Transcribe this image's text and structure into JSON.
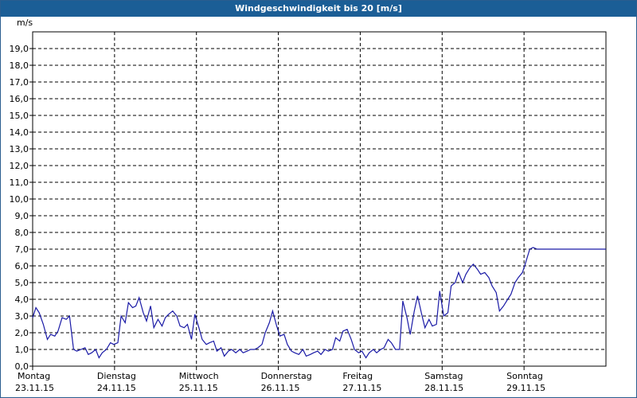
{
  "window": {
    "title": "Windgeschwindigkeit bis 20 [m/s]"
  },
  "colors": {
    "titlebar": "#1b5e96",
    "line": "#1a1aa6",
    "grid": "#000000"
  },
  "chart_data": {
    "type": "line",
    "title": "Windgeschwindigkeit bis 20 [m/s]",
    "ylabel": "m/s",
    "ylim": [
      0,
      20
    ],
    "yticks": [
      "0,0",
      "1,0",
      "2,0",
      "3,0",
      "4,0",
      "5,0",
      "6,0",
      "7,0",
      "8,0",
      "9,0",
      "10,0",
      "11,0",
      "12,0",
      "13,0",
      "14,0",
      "15,0",
      "16,0",
      "17,0",
      "18,0",
      "19,0"
    ],
    "ytick_values": [
      0,
      1,
      2,
      3,
      4,
      5,
      6,
      7,
      8,
      9,
      10,
      11,
      12,
      13,
      14,
      15,
      16,
      17,
      18,
      19
    ],
    "xlim": [
      0,
      7
    ],
    "day_ticks": [
      {
        "x": 0,
        "day": "Montag",
        "date": "23.11.15"
      },
      {
        "x": 1,
        "day": "Dienstag",
        "date": "24.11.15"
      },
      {
        "x": 2,
        "day": "Mittwoch",
        "date": "25.11.15"
      },
      {
        "x": 3,
        "day": "Donnerstag",
        "date": "26.11.15"
      },
      {
        "x": 4,
        "day": "Freitag",
        "date": "27.11.15"
      },
      {
        "x": 5,
        "day": "Samstag",
        "date": "28.11.15"
      },
      {
        "x": 6,
        "day": "Sonntag",
        "date": "29.11.15"
      }
    ],
    "grid": true,
    "series": [
      {
        "x": [
          0,
          0.04,
          0.08,
          0.13,
          0.18,
          0.22,
          0.27,
          0.31,
          0.36,
          0.41,
          0.45,
          0.5,
          0.54,
          0.59,
          0.64,
          0.68,
          0.72,
          0.77,
          0.81,
          0.85,
          0.9,
          0.95,
          0.99,
          1.04,
          1.08,
          1.13,
          1.17,
          1.22,
          1.26,
          1.3,
          1.35,
          1.39,
          1.44,
          1.48,
          1.53,
          1.58,
          1.62,
          1.66,
          1.71,
          1.76,
          1.8,
          1.85,
          1.89,
          1.94,
          1.98,
          2.03,
          2.07,
          2.12,
          2.16,
          2.21,
          2.25,
          2.3,
          2.34,
          2.39,
          2.43,
          2.48,
          2.53,
          2.57,
          2.62,
          2.66,
          2.71,
          2.75,
          2.8,
          2.84,
          2.89,
          2.93,
          2.98,
          3.02,
          3.07,
          3.11,
          3.16,
          3.2,
          3.25,
          3.3,
          3.34,
          3.39,
          3.43,
          3.48,
          3.52,
          3.57,
          3.61,
          3.66,
          3.7,
          3.75,
          3.79,
          3.84,
          3.89,
          3.93,
          3.98,
          4.02,
          4.07,
          4.11,
          4.16,
          4.2,
          4.25,
          4.29,
          4.34,
          4.38,
          4.43,
          4.48,
          4.52,
          4.57,
          4.61,
          4.66,
          4.7,
          4.75,
          4.79,
          4.84,
          4.88,
          4.93,
          4.97,
          5.02,
          5.07,
          5.11,
          5.16,
          5.2,
          5.25,
          5.29,
          5.34,
          5.38,
          5.43,
          5.47,
          5.52,
          5.57,
          5.61,
          5.66,
          5.7,
          5.75,
          5.8,
          5.84,
          5.89,
          5.93,
          5.98,
          6.02,
          6.07,
          6.11,
          6.16,
          6.2,
          6.25,
          6.29,
          6.34,
          6.38,
          6.43,
          6.48,
          6.52,
          6.57,
          6.61,
          6.66,
          6.7,
          6.75,
          6.79,
          6.84,
          6.88,
          6.93,
          6.97,
          7.0
        ],
        "y": [
          2.9,
          3.5,
          3.2,
          2.5,
          1.6,
          1.9,
          1.8,
          2.1,
          2.9,
          2.8,
          3.0,
          1.0,
          0.9,
          1.0,
          1.1,
          0.7,
          0.8,
          1.0,
          0.5,
          0.8,
          1.0,
          1.4,
          1.3,
          1.4,
          3.0,
          2.6,
          3.8,
          3.5,
          3.6,
          4.1,
          3.2,
          2.7,
          3.6,
          2.3,
          2.8,
          2.4,
          2.9,
          3.1,
          3.3,
          3.0,
          2.4,
          2.3,
          2.5,
          1.6,
          3.1,
          2.3,
          1.6,
          1.3,
          1.4,
          1.5,
          0.9,
          1.1,
          0.6,
          0.9,
          1.0,
          0.8,
          1.0,
          0.8,
          0.9,
          1.0,
          1.0,
          1.1,
          1.3,
          2.0,
          2.6,
          3.3,
          2.4,
          1.8,
          1.9,
          1.3,
          0.9,
          0.8,
          0.7,
          1.0,
          0.6,
          0.7,
          0.8,
          0.9,
          0.7,
          1.0,
          0.9,
          1.0,
          1.7,
          1.5,
          2.1,
          2.2,
          1.6,
          1.0,
          0.8,
          0.9,
          0.5,
          0.8,
          1.0,
          0.8,
          1.0,
          1.1,
          1.6,
          1.4,
          1.0,
          1.0,
          3.9,
          2.9,
          1.9,
          3.3,
          4.2,
          3.1,
          2.3,
          2.8,
          2.4,
          2.5,
          4.5,
          3.0,
          3.2,
          4.8,
          5.0,
          5.6,
          5.0,
          5.5,
          5.9,
          6.1,
          5.8,
          5.5,
          5.6,
          5.3,
          4.8,
          4.4,
          3.3,
          3.6,
          4.0,
          4.3,
          5.0,
          5.3,
          5.6,
          6.2,
          7.0,
          7.1,
          7.0,
          7.0,
          7.0,
          7.0,
          7.0,
          7.0,
          7.0,
          7.0,
          7.0,
          7.0,
          7.0,
          7.0,
          7.0,
          7.0,
          7.0,
          7.0,
          7.0,
          7.0,
          7.0,
          7.0
        ]
      }
    ]
  }
}
